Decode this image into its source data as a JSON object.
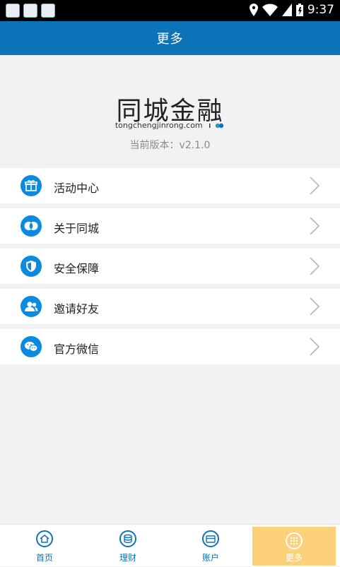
{
  "status": {
    "time": "9:37"
  },
  "header": {
    "title": "更多"
  },
  "brand": {
    "logo_text": "同城金融",
    "domain": "tongchengjinrong.com",
    "version": "当前版本：v2.1.0"
  },
  "menu": {
    "items": [
      {
        "label": "活动中心",
        "icon": "gift-icon"
      },
      {
        "label": "关于同城",
        "icon": "rings-icon"
      },
      {
        "label": "安全保障",
        "icon": "shield-icon"
      },
      {
        "label": "邀请好友",
        "icon": "people-icon"
      },
      {
        "label": "官方微信",
        "icon": "wechat-icon"
      }
    ]
  },
  "tabs": [
    {
      "label": "首页",
      "icon": "home-icon"
    },
    {
      "label": "理财",
      "icon": "coins-icon"
    },
    {
      "label": "账户",
      "icon": "wallet-icon"
    },
    {
      "label": "更多",
      "icon": "grid-icon",
      "active": true
    }
  ],
  "colors": {
    "primary": "#0d73b8",
    "icon_blue": "#0b8be0",
    "active_tab": "#fcd17a"
  }
}
